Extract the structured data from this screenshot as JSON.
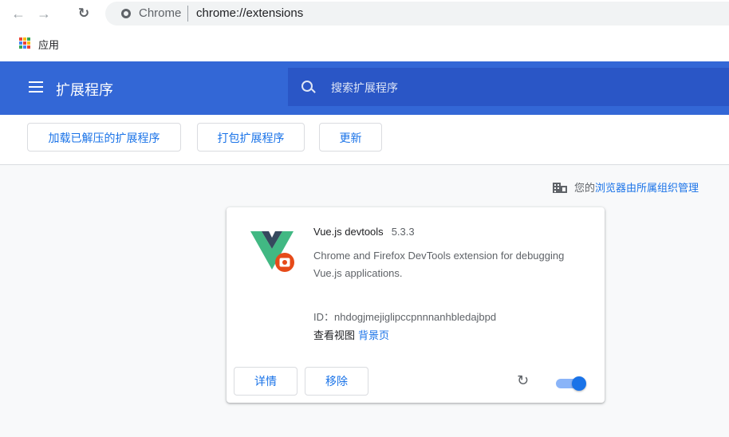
{
  "browser": {
    "site_name": "Chrome",
    "url": "chrome://extensions",
    "bookmark_apps_label": "应用"
  },
  "header": {
    "title": "扩展程序",
    "search_placeholder": "搜索扩展程序",
    "brand_color": "#3367d6"
  },
  "toolbar": {
    "load_unpacked": "加载已解压的扩展程序",
    "pack": "打包扩展程序",
    "update": "更新"
  },
  "managed_notice": {
    "prefix": "您的",
    "link": "浏览器由所属组织管理"
  },
  "extension": {
    "name": "Vue.js devtools",
    "version": "5.3.3",
    "description": "Chrome and Firefox DevTools extension for debugging Vue.js applications.",
    "id_label": "ID：",
    "id": "nhdogjmejiglipccpnnnanhbledajbpd",
    "views_label": "查看视图",
    "views_link": "背景页",
    "details_button": "详情",
    "remove_button": "移除",
    "enabled": true,
    "icon": "vue-devtools-logo"
  }
}
